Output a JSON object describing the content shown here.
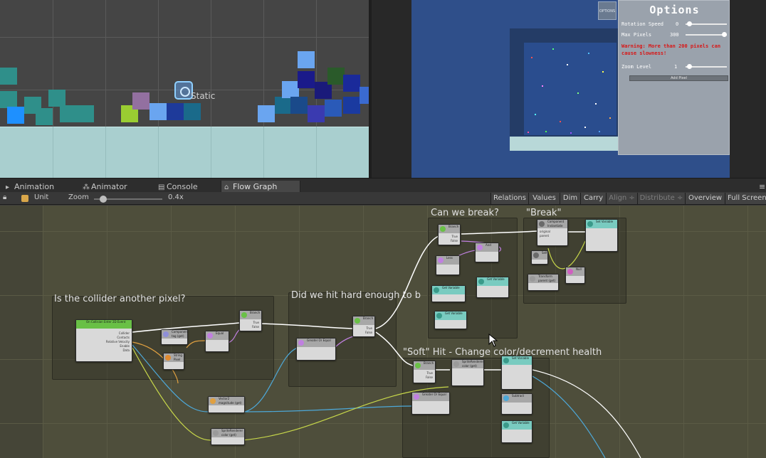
{
  "scene": {
    "static_label": "Static"
  },
  "game": {
    "options_button_label": "OPTIONS",
    "options": {
      "title": "Options",
      "rotation_speed_label": "Rotation Speed",
      "rotation_speed_value": "0",
      "max_pixels_label": "Max Pixels",
      "max_pixels_value": "300",
      "warning": "Warning: More than 200 pixels can cause slowness!",
      "zoom_level_label": "Zoom Level",
      "zoom_level_value": "1",
      "add_pixel_label": "Add Pixel"
    }
  },
  "tabs": [
    {
      "label": "Animation",
      "icon": "animation-icon"
    },
    {
      "label": "Animator",
      "icon": "animator-icon"
    },
    {
      "label": "Console",
      "icon": "console-icon"
    },
    {
      "label": "Flow Graph",
      "icon": "flow-graph-icon",
      "active": true
    }
  ],
  "toolbar": {
    "unit_label": "Unit",
    "zoom_label": "Zoom",
    "zoom_value": "0.4x",
    "buttons": [
      "Relations",
      "Values",
      "Dim",
      "Carry",
      "Align ÷",
      "Distribute ÷",
      "Overview",
      "Full Screen"
    ]
  },
  "graph": {
    "groups": [
      {
        "title": "Is the collider another pixel?"
      },
      {
        "title": "Did we hit hard enough to b"
      },
      {
        "title": "Can we break?"
      },
      {
        "title": "\"Break\""
      },
      {
        "title": "\"Soft\" Hit - Change color/decrement health"
      }
    ],
    "nodes": {
      "on_collision": "On Collision Enter 2D Event",
      "collider": "Collider",
      "contacts": "Contacts",
      "relative_velocity": "Relative Velocity",
      "enabled": "Enable",
      "data": "Data",
      "component_tag": "Component tag (get)",
      "string_pixel": "String Pixel",
      "equal": "Equal",
      "branch": "Branch",
      "true_label": "True",
      "false_label": "False",
      "vector2_magnitude": "Vector2 magnitude (get)",
      "sprite_renderer": "SpriteRenderer color (get)",
      "greater_or_equal": "Greater Or Equal",
      "and": "And",
      "less": "Less",
      "get_variable": "Get Variable",
      "set_variable": "Set Variable",
      "component_instantiate": "Component Instantiate",
      "original": "original",
      "parent": "parent",
      "self": "Self",
      "transform_parent": "Transform parent (get)",
      "null": "Null",
      "subtract": "Subtract"
    }
  }
}
